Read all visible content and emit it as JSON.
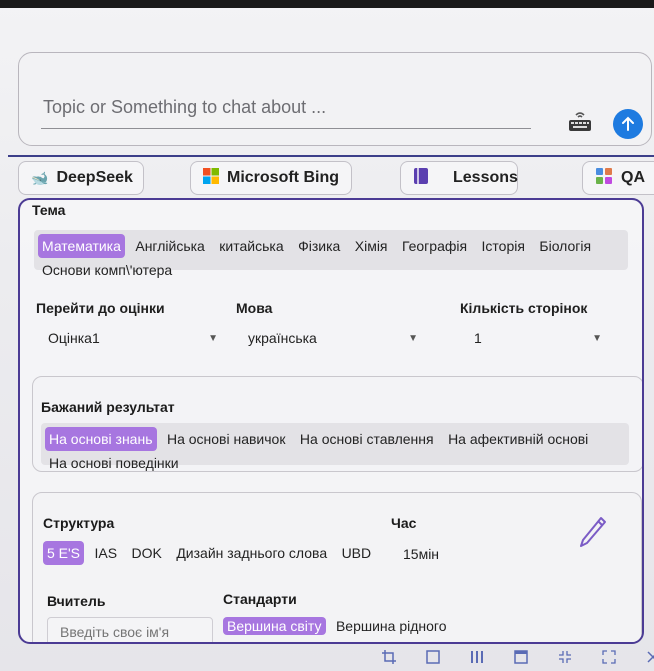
{
  "chat": {
    "placeholder": "Topic or Something to chat about ..."
  },
  "tools": [
    {
      "label": "DeepSeek",
      "icon": "deepseek-icon"
    },
    {
      "label": "Microsoft Bing",
      "icon": "microsoft-logo-icon"
    },
    {
      "label": "Lessons",
      "icon": "book-icon"
    },
    {
      "label": "QA",
      "icon": "qa-icon"
    }
  ],
  "topic": {
    "title": "Тема",
    "items": [
      "Математика",
      "Англійська",
      "китайська",
      "Фізика",
      "Хімія",
      "Географія",
      "Історія",
      "Біологія",
      "Основи комп\\'ютера"
    ],
    "selected": "Математика"
  },
  "filters": {
    "grade": {
      "label": "Перейти до оцінки",
      "value": "Оцінка1"
    },
    "language": {
      "label": "Мова",
      "value": "українська"
    },
    "pages": {
      "label": "Кількість сторінок",
      "value": "1"
    }
  },
  "outcome": {
    "title": "Бажаний результат",
    "items": [
      "На основі знань",
      "На основі навичок",
      "На основі ставлення",
      "На афективній основі",
      "На основі поведінки"
    ],
    "selected": "На основі знань"
  },
  "structure": {
    "title": "Структура",
    "items": [
      "5 E'S",
      "IAS",
      "DOK",
      "Дизайн заднього слова",
      "UBD"
    ],
    "selected": "5 E'S",
    "time_label": "Час",
    "time_value": "15мін"
  },
  "teacher": {
    "label": "Вчитель",
    "placeholder": "Введіть своє ім'я"
  },
  "standards": {
    "label": "Стандарти",
    "items": [
      "Вершина світу",
      "Вершина рідного"
    ],
    "selected": "Вершина світу"
  },
  "colors": {
    "accent": "#1e7be0",
    "chip_selected": "#a776e0",
    "panel_border": "#4b3b94"
  }
}
